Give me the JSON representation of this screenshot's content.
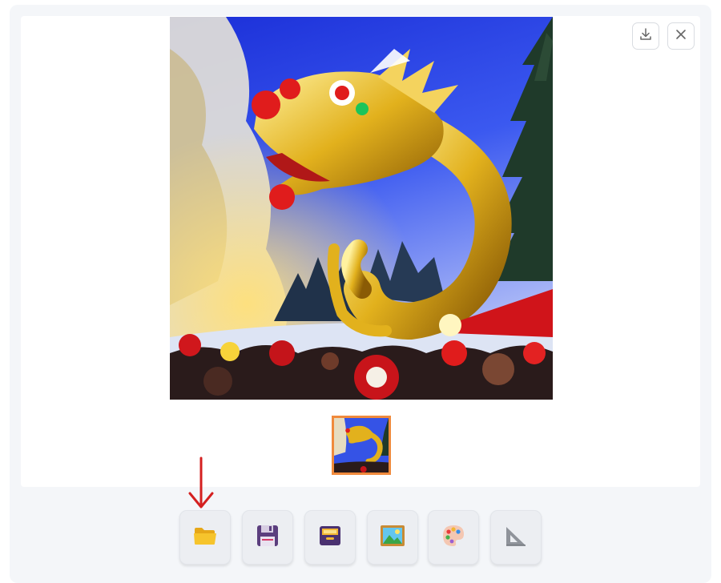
{
  "header_actions": [
    {
      "icon": "download-icon"
    },
    {
      "icon": "close-icon"
    }
  ],
  "gallery": {
    "main_image": "chinese-dragon-lantern-festival-winter",
    "thumbnails": [
      {
        "image": "chinese-dragon-lantern-festival-winter",
        "selected": true
      }
    ]
  },
  "toolbar": {
    "buttons": [
      {
        "icon": "folder-icon"
      },
      {
        "icon": "floppy-disk-icon"
      },
      {
        "icon": "save-box-icon"
      },
      {
        "icon": "image-icon"
      },
      {
        "icon": "palette-icon"
      },
      {
        "icon": "set-square-icon"
      }
    ]
  },
  "annotation": {
    "arrow_color": "#d42020",
    "points_to": "folder-icon"
  },
  "colors": {
    "thumbnail_border": "#f08a3c",
    "toolbar_background": "#eceef2",
    "app_background": "#f4f6f9"
  }
}
